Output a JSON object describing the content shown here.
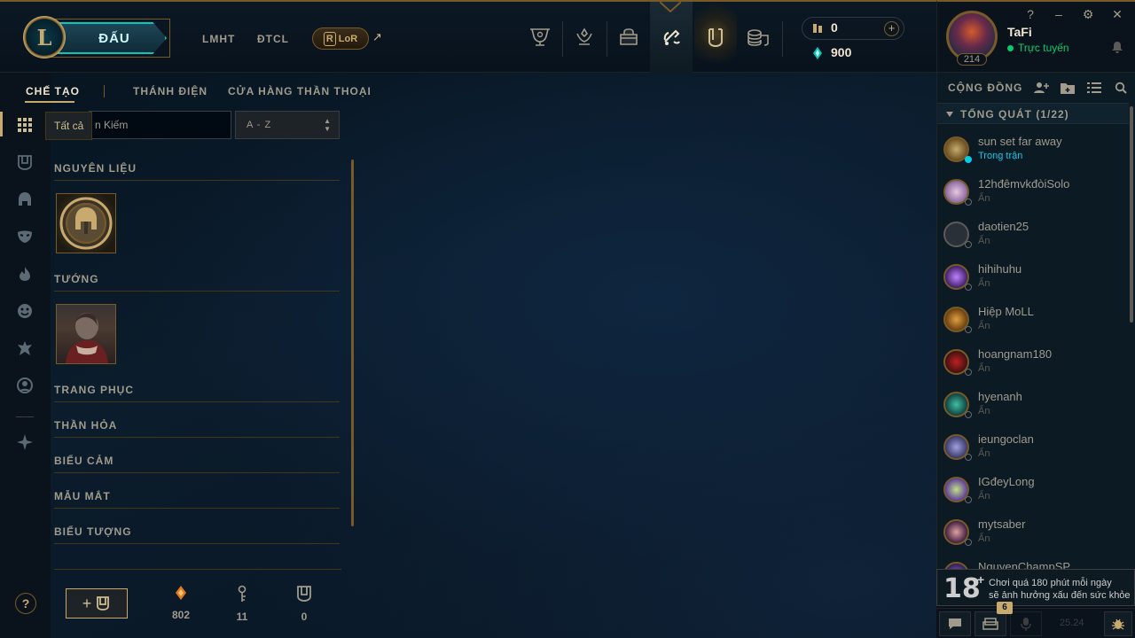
{
  "topnav": {
    "play_label": "ĐẤU",
    "links": [
      "LMHT",
      "ĐTCL"
    ],
    "lor_label": "LoR",
    "external_arrow": "↗",
    "icons": [
      "trophy-icon",
      "ranked-icon",
      "store-icon",
      "loot-icon",
      "collection-icon",
      "coins-icon"
    ]
  },
  "currency": {
    "rp": "0",
    "be": "900",
    "plus": "+"
  },
  "profile": {
    "name": "TaFi",
    "status": "Trực tuyến",
    "level": "214",
    "window_buttons": [
      "?",
      "–",
      "⚙",
      "✕"
    ]
  },
  "subnav": {
    "tabs": [
      "CHẾ TẠO",
      "THÁNH ĐIỆN",
      "CỬA HÀNG THẦN THOẠI"
    ]
  },
  "filter": {
    "tooltip": "Tất cả",
    "search_placeholder": "Tìm Kiếm",
    "search_visible": "n Kiếm",
    "sort_value": "A - Z"
  },
  "categories": [
    "NGUYÊN LIỆU",
    "TƯỚNG",
    "TRANG PHỤC",
    "THẦN HỎA",
    "BIỂU CẢM",
    "MẪU MẮT",
    "BIỂU TƯỢNG"
  ],
  "resources": [
    {
      "icon": "orange-essence-icon",
      "value": "802"
    },
    {
      "icon": "key-fragment-icon",
      "value": "11"
    },
    {
      "icon": "chest-icon",
      "value": "0"
    }
  ],
  "craft": {
    "label": "+"
  },
  "help": "?",
  "friends": {
    "header": "CỘNG ĐỒNG",
    "group": "TỔNG QUÁT (1/22)",
    "list": [
      {
        "name": "sun set far away",
        "sub": "Trong trận",
        "ingame": true
      },
      {
        "name": "12hđêmvkđòiSolo",
        "sub": "Ẩn",
        "ingame": false
      },
      {
        "name": "daotien25",
        "sub": "Ẩn",
        "ingame": false
      },
      {
        "name": "hihihuhu",
        "sub": "Ẩn",
        "ingame": false
      },
      {
        "name": "Hiệp MoLL",
        "sub": "Ẩn",
        "ingame": false
      },
      {
        "name": "hoangnam180",
        "sub": "Ẩn",
        "ingame": false
      },
      {
        "name": "hyenanh",
        "sub": "Ẩn",
        "ingame": false
      },
      {
        "name": "ieungoclan",
        "sub": "Ẩn",
        "ingame": false
      },
      {
        "name": "IGđeyLong",
        "sub": "Ẩn",
        "ingame": false
      },
      {
        "name": "mytsaber",
        "sub": "Ẩn",
        "ingame": false
      },
      {
        "name": "NguyenChampSP",
        "sub": "",
        "ingame": false
      }
    ]
  },
  "age_notice": {
    "age": "18",
    "plus": "+",
    "line1": "Chơi quá 180 phút mỗi ngày",
    "line2": "sẽ ảnh hưởng xấu đến sức khỏe"
  },
  "bottombar": {
    "badge": "6",
    "version": "25.24"
  },
  "colors": {
    "gold": "#c8aa6e",
    "gold_dark": "#785a28",
    "teal": "#0ac8b9",
    "online": "#0acb6b",
    "ingame": "#0acbe6"
  }
}
